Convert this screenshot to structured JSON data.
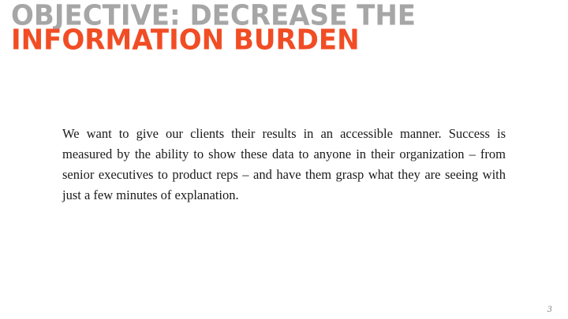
{
  "slide": {
    "title_line_1": "OBJECTIVE: DECREASE THE",
    "title_line_2": "INFORMATION BURDEN",
    "body": "We want to give our clients their results in an accessible manner.  Success is measured by the ability to show these data to anyone in their organization – from senior executives to product reps – and have them grasp what they are seeing with just a few minutes of explanation.",
    "page_number": "3"
  },
  "colors": {
    "title_line_1": "#a6a6a6",
    "title_line_2": "#f14d25",
    "body_text": "#1a1a1a",
    "background": "#ffffff"
  }
}
